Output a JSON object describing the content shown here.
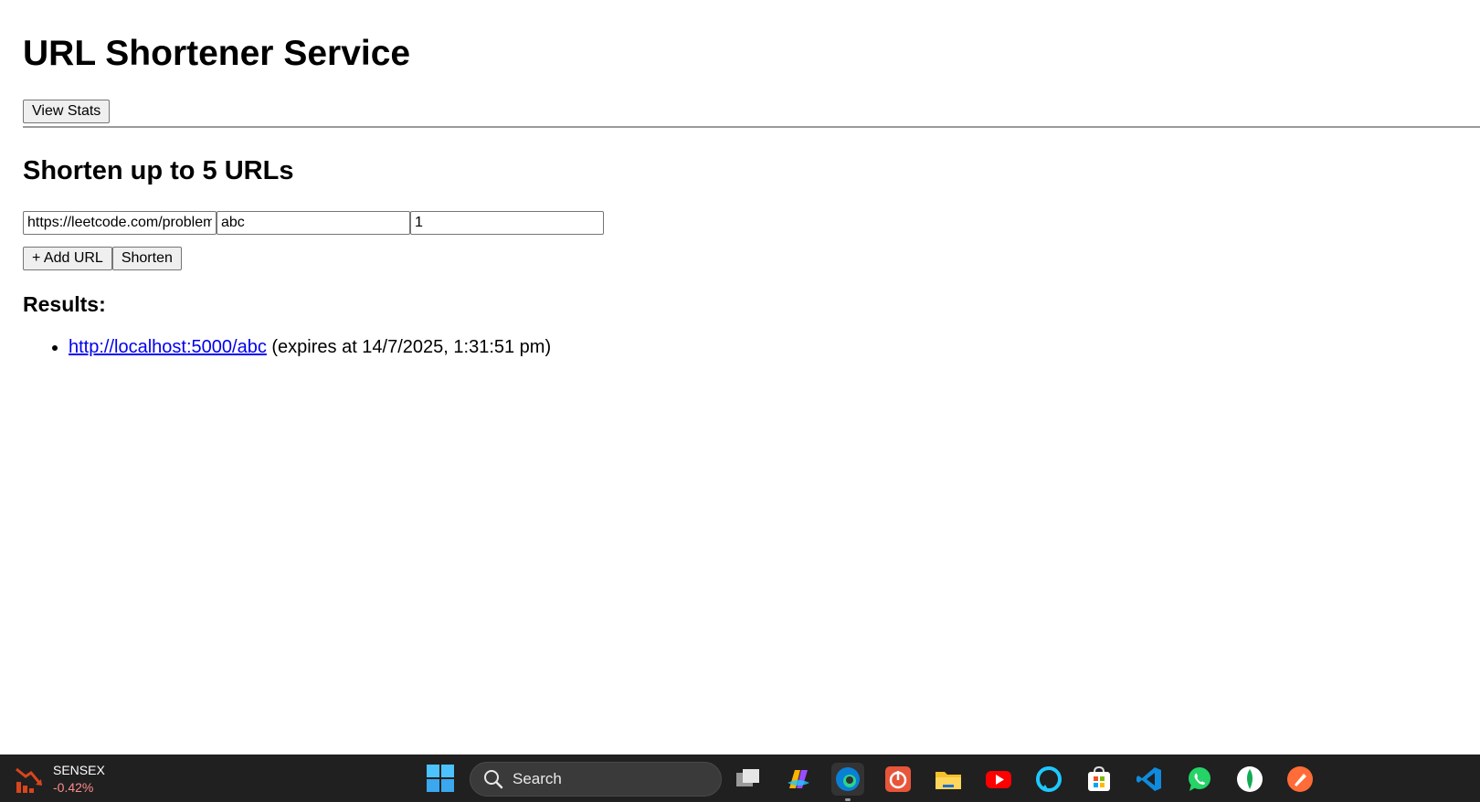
{
  "page": {
    "title": "URL Shortener Service",
    "view_stats_label": "View Stats",
    "section_title": "Shorten up to 5 URLs",
    "inputs": {
      "url_value": "https://leetcode.com/problems",
      "shortcode_value": "abc",
      "validity_value": "1"
    },
    "add_url_label": "+ Add URL",
    "shorten_label": "Shorten",
    "results_heading": "Results:",
    "results": [
      {
        "short_url": "http://localhost:5000/abc",
        "expiry_text": " (expires at 14/7/2025, 1:31:51 pm)"
      }
    ],
    "link_color": "#0000ee"
  },
  "taskbar": {
    "ticker": {
      "name": "SENSEX",
      "change": "-0.42%",
      "change_color": "#ff8a8a"
    },
    "search_label": "Search",
    "apps": [
      "task-view-icon",
      "copilot-icon",
      "edge-icon",
      "power-app-icon",
      "file-explorer-icon",
      "youtube-icon",
      "alexa-icon",
      "microsoft-store-icon",
      "vscode-icon",
      "whatsapp-icon",
      "mongodb-compass-icon",
      "postman-icon"
    ]
  }
}
